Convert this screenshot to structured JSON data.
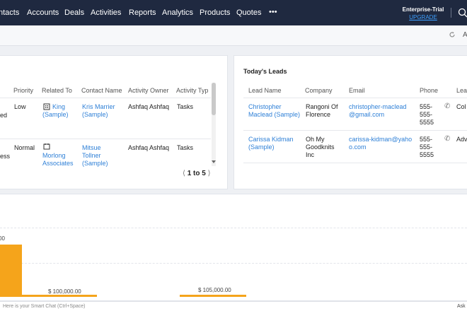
{
  "nav": {
    "items": [
      "ntacts",
      "Accounts",
      "Deals",
      "Activities",
      "Reports",
      "Analytics",
      "Products",
      "Quotes",
      "•••"
    ],
    "trial_label": "Enterprise-Trial",
    "upgrade_label": "UPGRADE"
  },
  "toolbar": {
    "right_letter": "A"
  },
  "activities": {
    "columns": [
      "Priority",
      "Related To",
      "Contact Name",
      "Activity Owner",
      "Activity Typ"
    ],
    "rows": [
      {
        "status_tail": "ed",
        "priority": "Low",
        "related_to": "King (Sample)",
        "contact": "Kris Marrier (Sample)",
        "owner": "Ashfaq Ashfaq",
        "type": "Tasks"
      },
      {
        "status_tail": "ess",
        "priority": "Normal",
        "related_to": "Morlong Associates",
        "contact": "Mitsue Tollner (Sample)",
        "owner": "Ashfaq Ashfaq",
        "type": "Tasks"
      }
    ],
    "pager": {
      "range": "1 to 5"
    }
  },
  "leads": {
    "title": "Today's Leads",
    "columns": [
      "Lead Name",
      "Company",
      "Email",
      "Phone",
      "Lea"
    ],
    "rows": [
      {
        "name": "Christopher Maclead (Sample)",
        "company": "Rangoni Of Florence",
        "email": "christopher-maclead@gmail.com",
        "phone": "555-555-5555",
        "source": "Col"
      },
      {
        "name": "Carissa Kidman (Sample)",
        "company": "Oh My Goodknits Inc",
        "email": "carissa-kidman@yahoo.com",
        "phone": "555-555-5555",
        "source": "Adv"
      }
    ]
  },
  "chart_data": {
    "type": "bar",
    "title": "",
    "bar_labels": [
      "00",
      "$ 100,000.00",
      "$ 105,000.00"
    ],
    "values": [
      null,
      100000,
      105000
    ],
    "color": "#f5a41b"
  },
  "footer": {
    "smart_chat": "Here is your Smart Chat (Ctrl+Space)",
    "ask": "Ask"
  }
}
